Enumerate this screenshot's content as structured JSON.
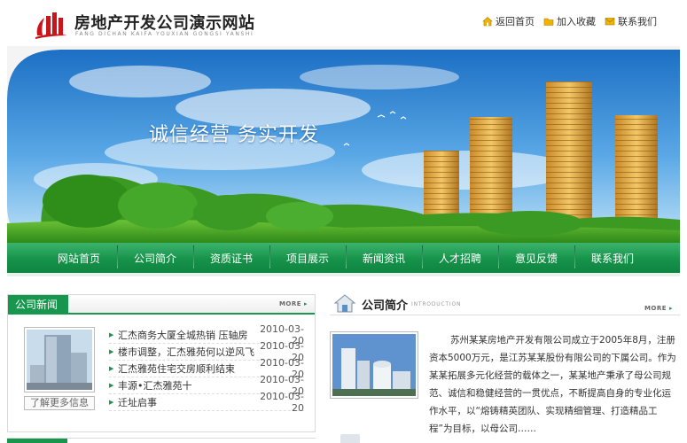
{
  "header": {
    "title": "房地产开发公司演示网站",
    "subtitle": "FANG DICHAN KAIFA YOUXIAN GONGSI YANSHI",
    "links": [
      {
        "label": "返回首页",
        "icon": "home-icon"
      },
      {
        "label": "加入收藏",
        "icon": "folder-icon"
      },
      {
        "label": "联系我们",
        "icon": "mail-icon"
      }
    ]
  },
  "banner": {
    "slogan": "诚信经营  务实开发"
  },
  "nav": {
    "items": [
      "网站首页",
      "公司简介",
      "资质证书",
      "项目展示",
      "新闻资讯",
      "人才招聘",
      "意见反馈",
      "联系我们"
    ]
  },
  "news": {
    "tab_label": "公司新闻",
    "more_label": "MORE",
    "photo_button": "了解更多信息",
    "items": [
      {
        "title": "汇杰商务大厦全城热销 压轴房",
        "date": "2010-03-20"
      },
      {
        "title": "楼市调整，汇杰雅苑何以逆风飞",
        "date": "2010-03-20"
      },
      {
        "title": "汇杰雅苑住宅交房顺利结束",
        "date": "2010-03-20"
      },
      {
        "title": "丰源•汇杰雅苑十",
        "date": "2010-03-20"
      },
      {
        "title": "迁址启事",
        "date": "2010-03-20"
      }
    ]
  },
  "intro": {
    "title": "公司简介",
    "subtitle": "INTRODUCTION",
    "more_label": "MORE",
    "text": "苏州某某房地产开发有限公司成立于2005年8月，注册资本5000万元，是江苏某某股份有限公司的下属公司。作为某某拓展多元化经营的载体之一，某某地产秉承了母公司规范、诚信和稳健经营的一贯优点，不断提高自身的专业化运作水平，以“熔铸精英团队、实现精细管理、打造精品工程”为目标，以母公司……"
  },
  "colors": {
    "accent_green": "#17964e",
    "logo_red": "#c8161d"
  }
}
